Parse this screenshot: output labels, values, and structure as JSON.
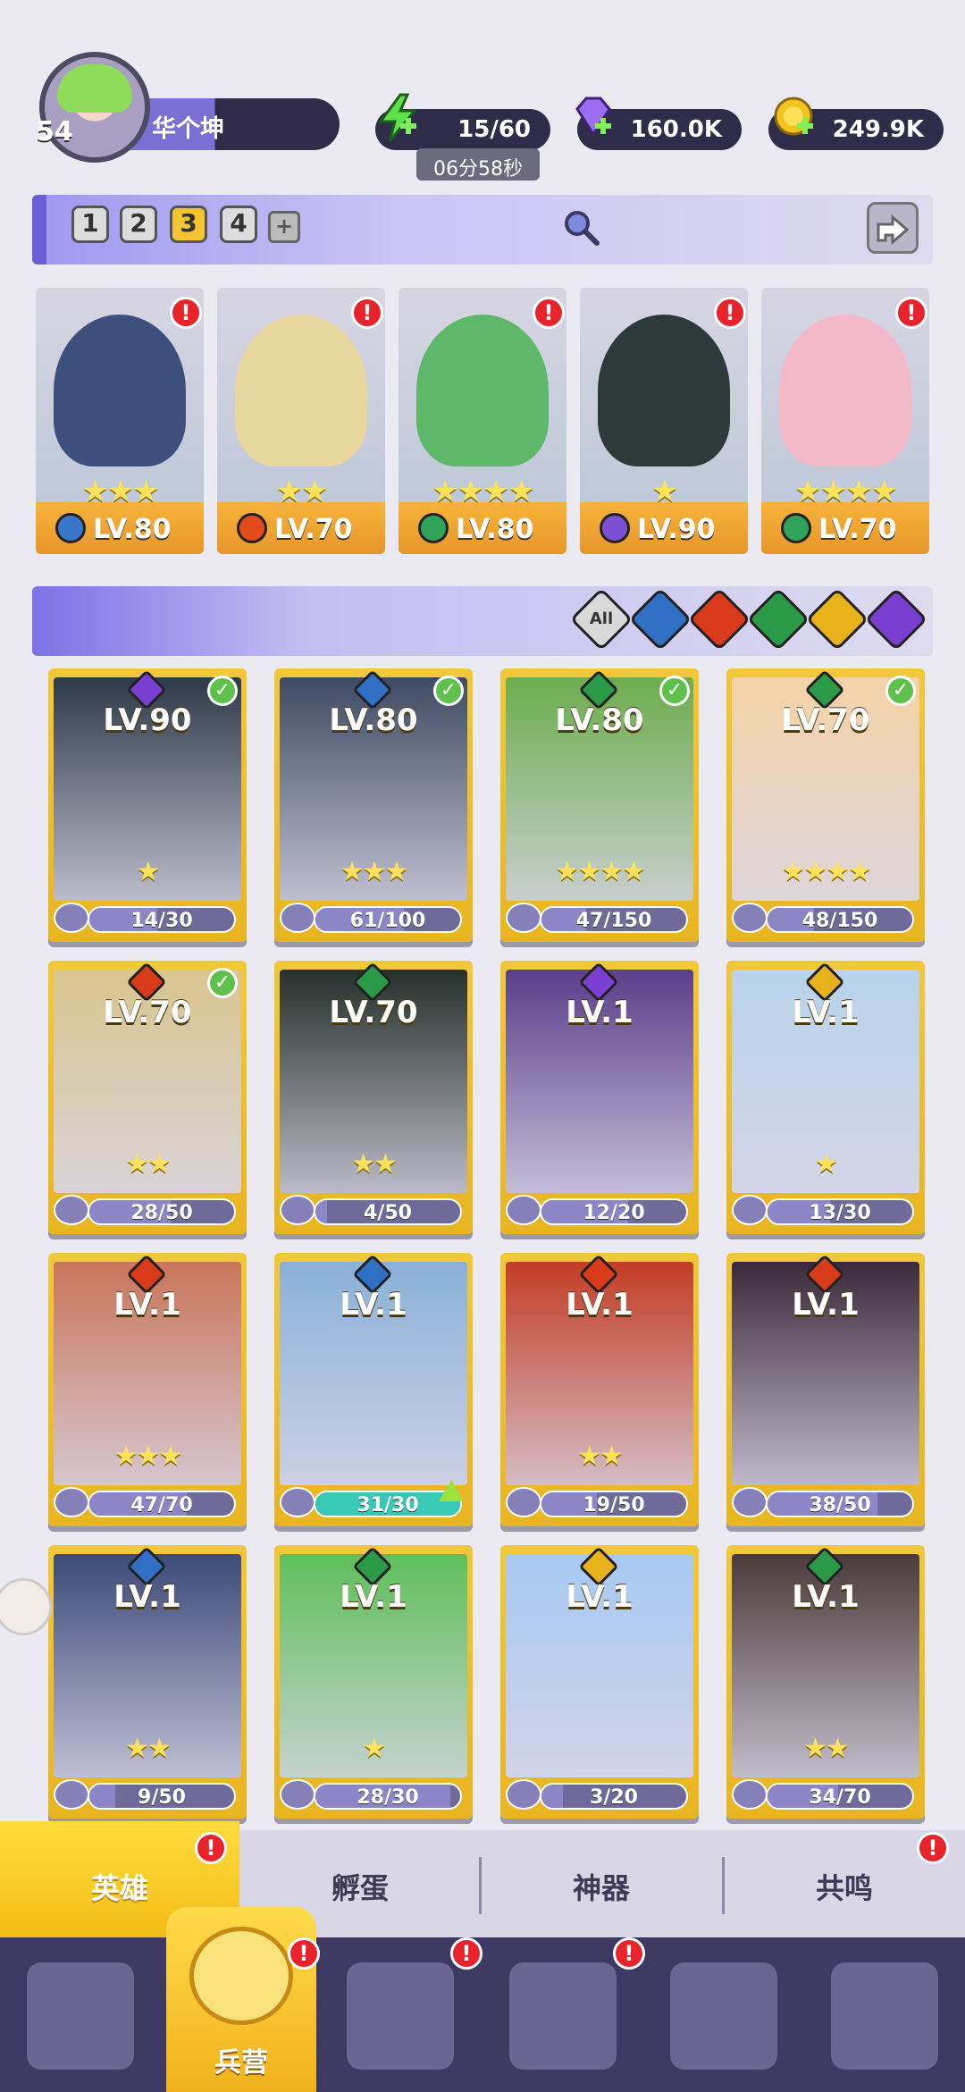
{
  "player": {
    "level": "54",
    "name": "华个坤"
  },
  "resources": {
    "energy": "15/60",
    "energy_timer": "06分58秒",
    "gems": "160.0K",
    "gold": "249.9K"
  },
  "teams": {
    "tabs": [
      "1",
      "2",
      "3",
      "4"
    ],
    "active": "3",
    "plus": "+"
  },
  "team_heroes": [
    {
      "level": "LV.80",
      "stars": "★★★",
      "element": "water",
      "color": "#3a76c9"
    },
    {
      "level": "LV.70",
      "stars": "★★",
      "element": "fire",
      "color": "#e24a1c"
    },
    {
      "level": "LV.80",
      "stars": "★★★★",
      "element": "wood",
      "color": "#2fa35a"
    },
    {
      "level": "LV.90",
      "stars": "★",
      "element": "dark",
      "color": "#7c4ed1"
    },
    {
      "level": "LV.70",
      "stars": "★★★★",
      "element": "wood",
      "color": "#2fa35a"
    }
  ],
  "filters": [
    "All",
    "water",
    "fire",
    "wood",
    "light",
    "dark"
  ],
  "filter_colors": [
    "#888888",
    "#2f6fc4",
    "#d83a1a",
    "#2a9a48",
    "#e8b21a",
    "#7a3fd0"
  ],
  "heroes": [
    {
      "level": "LV.90",
      "progress": "14/30",
      "fraction": 0.47,
      "stars": "★",
      "element": "dark",
      "color": "#7a3fd0",
      "check": true
    },
    {
      "level": "LV.80",
      "progress": "61/100",
      "fraction": 0.61,
      "stars": "★★★",
      "element": "water",
      "color": "#2f6fc4",
      "check": true
    },
    {
      "level": "LV.80",
      "progress": "47/150",
      "fraction": 0.31,
      "stars": "★★★★",
      "element": "wood",
      "color": "#2a9a48",
      "check": true
    },
    {
      "level": "LV.70",
      "progress": "48/150",
      "fraction": 0.32,
      "stars": "★★★★",
      "element": "wood",
      "color": "#2a9a48",
      "check": true
    },
    {
      "level": "LV.70",
      "progress": "28/50",
      "fraction": 0.56,
      "stars": "★★",
      "element": "fire",
      "color": "#d83a1a",
      "check": true
    },
    {
      "level": "LV.70",
      "progress": "4/50",
      "fraction": 0.08,
      "stars": "★★",
      "element": "wood",
      "color": "#2a9a48",
      "check": false
    },
    {
      "level": "LV.1",
      "progress": "12/20",
      "fraction": 0.6,
      "stars": "",
      "element": "dark",
      "color": "#7a3fd0",
      "check": false
    },
    {
      "level": "LV.1",
      "progress": "13/30",
      "fraction": 0.43,
      "stars": "★",
      "element": "light",
      "color": "#e8b21a",
      "check": false
    },
    {
      "level": "LV.1",
      "progress": "47/70",
      "fraction": 0.67,
      "stars": "★★★",
      "element": "fire",
      "color": "#d83a1a",
      "check": false
    },
    {
      "level": "LV.1",
      "progress": "31/30",
      "fraction": 1.0,
      "stars": "",
      "element": "water",
      "color": "#2f6fc4",
      "check": false,
      "upgrade": true
    },
    {
      "level": "LV.1",
      "progress": "19/50",
      "fraction": 0.38,
      "stars": "★★",
      "element": "fire",
      "color": "#d83a1a",
      "check": false
    },
    {
      "level": "LV.1",
      "progress": "38/50",
      "fraction": 0.76,
      "stars": "",
      "element": "fire",
      "color": "#d83a1a",
      "check": false
    },
    {
      "level": "LV.1",
      "progress": "9/50",
      "fraction": 0.18,
      "stars": "★★",
      "element": "water",
      "color": "#2f6fc4",
      "check": false
    },
    {
      "level": "LV.1",
      "progress": "28/30",
      "fraction": 0.93,
      "stars": "★",
      "element": "wood",
      "color": "#2a9a48",
      "check": false
    },
    {
      "level": "LV.1",
      "progress": "3/20",
      "fraction": 0.15,
      "stars": "",
      "element": "light",
      "color": "#e8b21a",
      "check": false
    },
    {
      "level": "LV.1",
      "progress": "34/70",
      "fraction": 0.49,
      "stars": "★★",
      "element": "wood",
      "color": "#2a9a48",
      "check": false
    }
  ],
  "sub_tabs": {
    "heroes": "英雄",
    "hatch": "孵蛋",
    "artifacts": "神器",
    "resonance": "共鸣"
  },
  "nav": {
    "barracks": "兵营"
  },
  "alert_mark": "!",
  "check_mark": "✓"
}
